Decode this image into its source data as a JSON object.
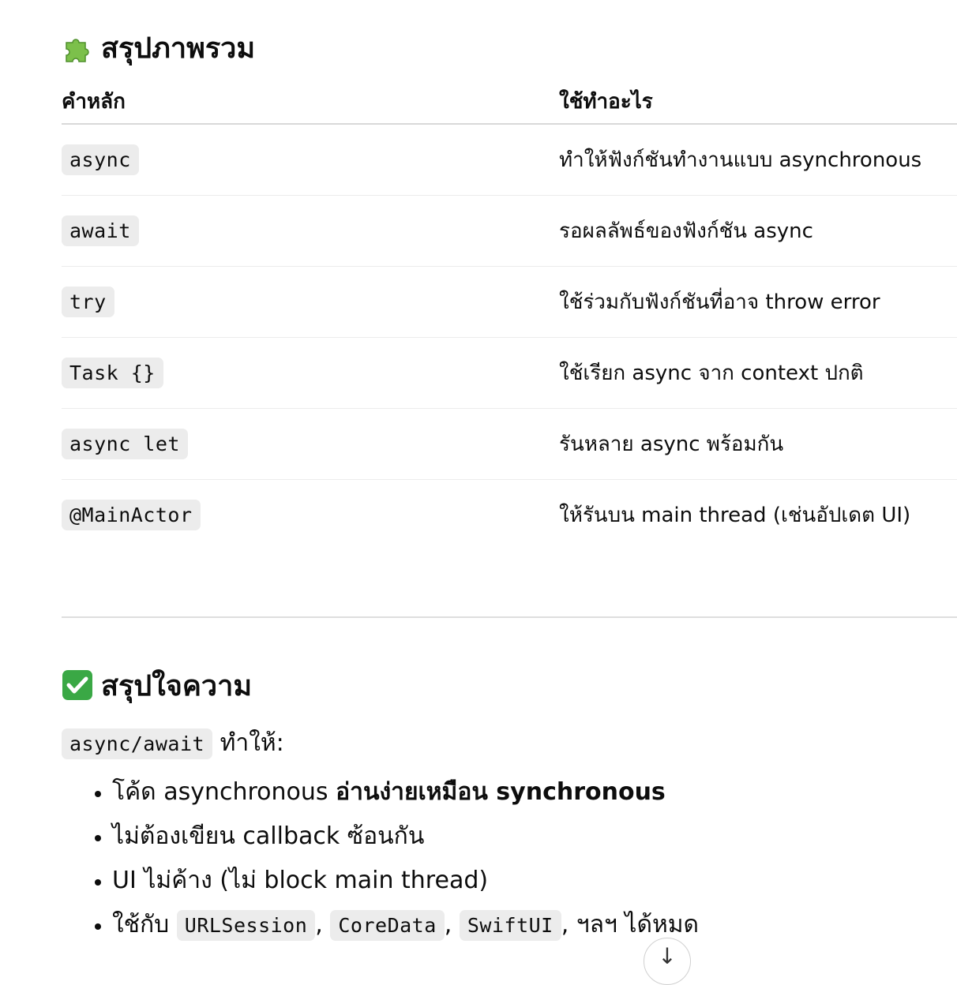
{
  "overview": {
    "emoji": "🧩",
    "title": "สรุปภาพรวม",
    "headers": [
      "คำหลัก",
      "ใช้ทำอะไร"
    ],
    "rows": [
      {
        "keyword": "async",
        "desc": "ทำให้ฟังก์ชันทำงานแบบ asynchronous"
      },
      {
        "keyword": "await",
        "desc": "รอผลลัพธ์ของฟังก์ชัน async"
      },
      {
        "keyword": "try",
        "desc": "ใช้ร่วมกับฟังก์ชันที่อาจ throw error"
      },
      {
        "keyword": "Task {}",
        "desc": "ใช้เรียก async จาก context ปกติ"
      },
      {
        "keyword": "async let",
        "desc": "รันหลาย async พร้อมกัน"
      },
      {
        "keyword": "@MainActor",
        "desc": "ให้รันบน main thread (เช่นอัปเดต UI)"
      }
    ]
  },
  "summary": {
    "emoji": "✅",
    "title": "สรุปใจความ",
    "intro_code": "async/await",
    "intro_text": " ทำให้:",
    "bullets": {
      "b1_text": "โค้ด asynchronous ",
      "b1_bold": "อ่านง่ายเหมือน synchronous",
      "b2": "ไม่ต้องเขียน callback ซ้อนกัน",
      "b3": "UI ไม่ค้าง (ไม่ block main thread)",
      "b4_prefix": "ใช้กับ ",
      "b4_code1": "URLSession",
      "b4_code2": "CoreData",
      "b4_code3": "SwiftUI",
      "b4_suffix": ", ฯลฯ ได้หมด"
    }
  },
  "scroll_button": {
    "icon": "arrow-down-icon",
    "glyph": "↓"
  }
}
